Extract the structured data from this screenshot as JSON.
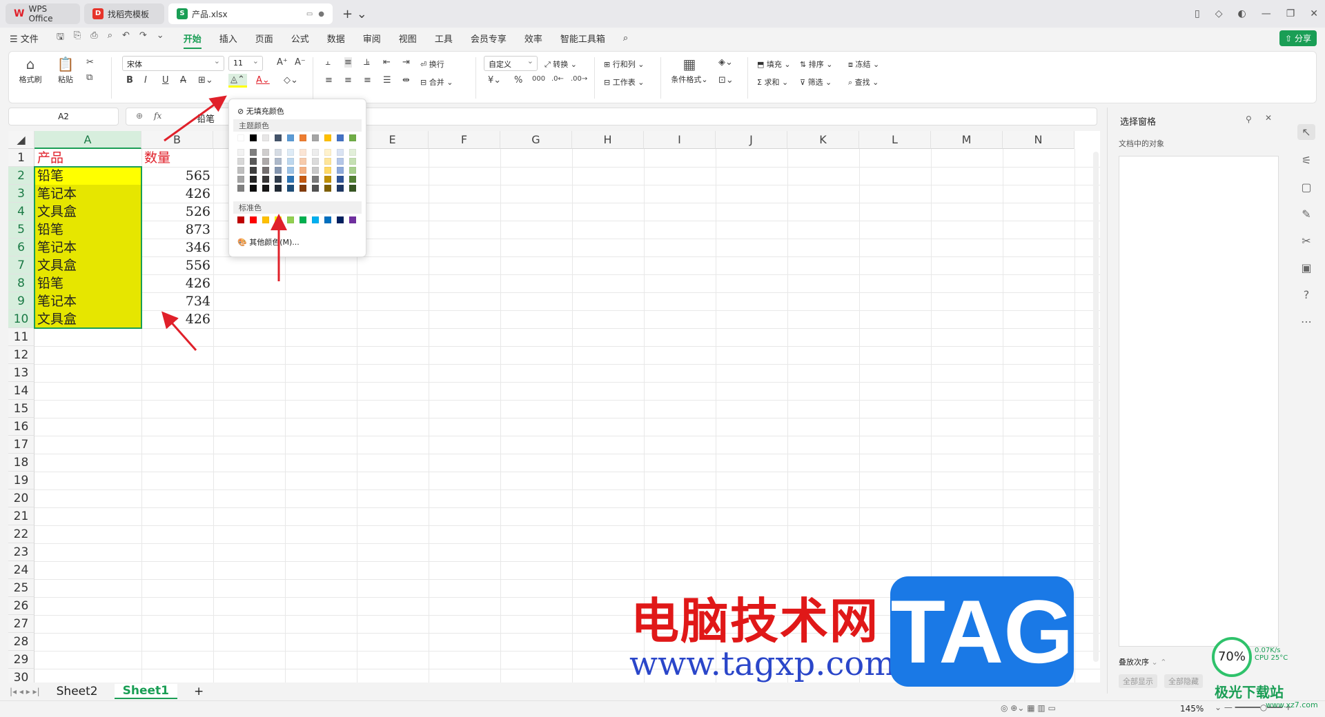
{
  "tabs": {
    "wps": "WPS Office",
    "templates": "找稻壳模板",
    "file": "产品.xlsx"
  },
  "menu": {
    "file": "文件",
    "items": [
      "开始",
      "插入",
      "页面",
      "公式",
      "数据",
      "审阅",
      "视图",
      "工具",
      "会员专享",
      "效率",
      "智能工具箱"
    ],
    "share": "分享"
  },
  "ribbon": {
    "format_painter": "格式刷",
    "paste": "粘贴",
    "font": "宋体",
    "font_size": "11",
    "wrap": "换行",
    "merge": "合并",
    "number_format": "自定义",
    "convert": "转换",
    "rows_cols": "行和列",
    "worksheet": "工作表",
    "cond_format": "条件格式",
    "fill": "填充",
    "sort": "排序",
    "freeze": "冻结",
    "sum": "求和",
    "filter": "筛选",
    "find": "查找"
  },
  "formula_bar": {
    "name_box": "A2",
    "fx": "fx",
    "value": "铅笔"
  },
  "grid": {
    "columns": [
      "A",
      "B",
      "C",
      "D",
      "E",
      "F",
      "G",
      "H",
      "I",
      "J",
      "K",
      "L",
      "M",
      "N"
    ],
    "rows": [
      "1",
      "2",
      "3",
      "4",
      "5",
      "6",
      "7",
      "8",
      "9",
      "10",
      "11",
      "12",
      "13",
      "14",
      "15",
      "16",
      "17",
      "18",
      "19",
      "20",
      "21",
      "22",
      "23",
      "24",
      "25",
      "26",
      "27",
      "28",
      "29",
      "30"
    ],
    "header": {
      "a": "产品",
      "b": "数量"
    },
    "data": [
      {
        "product": "铅笔",
        "qty": "565"
      },
      {
        "product": "笔记本",
        "qty": "426"
      },
      {
        "product": "文具盒",
        "qty": "526"
      },
      {
        "product": "铅笔",
        "qty": "873"
      },
      {
        "product": "笔记本",
        "qty": "346"
      },
      {
        "product": "文具盒",
        "qty": "556"
      },
      {
        "product": "铅笔",
        "qty": "426"
      },
      {
        "product": "笔记本",
        "qty": "734"
      },
      {
        "product": "文具盒",
        "qty": "426"
      }
    ],
    "fill_color": "#e6e600"
  },
  "color_popup": {
    "no_fill": "无填充颜色",
    "theme_label": "主题颜色",
    "standard_label": "标准色",
    "more": "其他颜色(M)...",
    "theme_top": [
      "#ffffff",
      "#000000",
      "#e7e6e6",
      "#44546a",
      "#5b9bd5",
      "#ed7d31",
      "#a5a5a5",
      "#ffc000",
      "#4472c4",
      "#70ad47"
    ],
    "theme_shades": [
      [
        "#f2f2f2",
        "#7f7f7f",
        "#d0cece",
        "#d6dce4",
        "#deebf6",
        "#fbe5d5",
        "#ededed",
        "#fff2cc",
        "#dae3f3",
        "#e2efd9"
      ],
      [
        "#d8d8d8",
        "#595959",
        "#aeaaaa",
        "#adb9ca",
        "#bdd7ee",
        "#f7cbac",
        "#dbdbdb",
        "#fee599",
        "#b4c6e7",
        "#c5e0b3"
      ],
      [
        "#bfbfbf",
        "#3f3f3f",
        "#757070",
        "#8496b0",
        "#9dc3e6",
        "#f4b183",
        "#c9c9c9",
        "#ffd965",
        "#8eaadb",
        "#a8d08d"
      ],
      [
        "#a5a5a5",
        "#262626",
        "#3a3838",
        "#323f4f",
        "#2e75b5",
        "#c55a11",
        "#7b7b7b",
        "#bf9000",
        "#2f5496",
        "#538135"
      ],
      [
        "#7f7f7f",
        "#0c0c0c",
        "#171616",
        "#222a35",
        "#1e4e79",
        "#833c0b",
        "#525252",
        "#7f6000",
        "#1f3864",
        "#375623"
      ]
    ],
    "standard": [
      "#c00000",
      "#ff0000",
      "#ffc000",
      "#ffff00",
      "#92d050",
      "#00b050",
      "#00b0f0",
      "#0070c0",
      "#002060",
      "#7030a0"
    ]
  },
  "pane": {
    "title": "选择窗格",
    "subtitle": "文档中的对象",
    "order": "叠放次序",
    "show_all": "全部显示",
    "hide_all": "全部隐藏"
  },
  "sheets": [
    "Sheet2",
    "Sheet1"
  ],
  "status": {
    "zoom": "145%"
  },
  "watermark": {
    "cn": "电脑技术网",
    "url": "www.tagxp.com",
    "tag": "TAG",
    "site": "极光下载站",
    "site_url": "www.xz7.com"
  },
  "cpu": {
    "percent": "70%",
    "speed": "0.07K/s",
    "temp": "CPU 25°C"
  }
}
